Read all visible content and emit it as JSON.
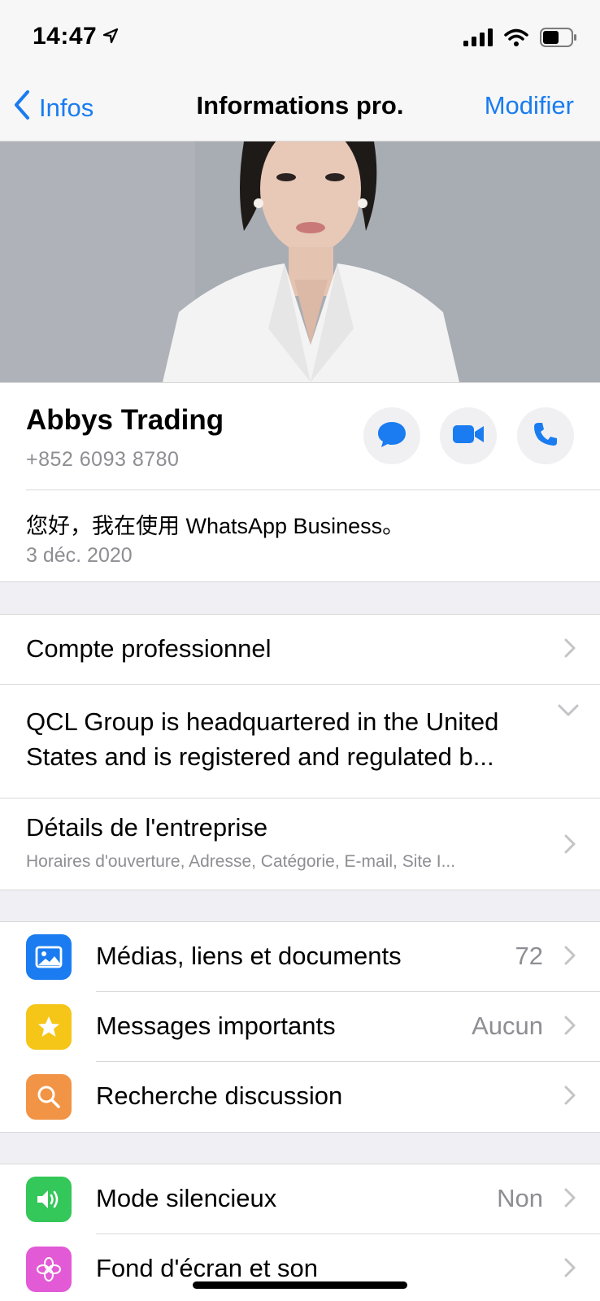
{
  "status_bar": {
    "time": "14:47"
  },
  "nav": {
    "back_label": "Infos",
    "title": "Informations pro.",
    "edit_label": "Modifier"
  },
  "profile": {
    "name": "Abbys Trading",
    "phone": "+852 6093 8780",
    "about": "您好，我在使用 WhatsApp Business。",
    "about_date": "3 déc. 2020",
    "actions": [
      "message",
      "video-call",
      "voice-call"
    ]
  },
  "business": {
    "account_label": "Compte professionnel",
    "description": "QCL Group is headquartered in the United States and is registered and regulated b...",
    "details_label": "Détails de l'entreprise",
    "details_sub": "Horaires d'ouverture, Adresse, Catégorie, E-mail, Site I..."
  },
  "media_section": [
    {
      "icon": "photo-icon",
      "label": "Médias, liens et documents",
      "value": "72",
      "color": "#1a7cf0"
    },
    {
      "icon": "star-icon",
      "label": "Messages importants",
      "value": "Aucun",
      "color": "#f5c518"
    },
    {
      "icon": "search-icon",
      "label": "Recherche discussion",
      "value": "",
      "color": "#f29445"
    }
  ],
  "settings_section": [
    {
      "icon": "speaker-icon",
      "label": "Mode silencieux",
      "value": "Non",
      "color": "#34c759"
    },
    {
      "icon": "flower-icon",
      "label": "Fond d'écran et son",
      "value": "",
      "color": "#e25ad6"
    }
  ]
}
